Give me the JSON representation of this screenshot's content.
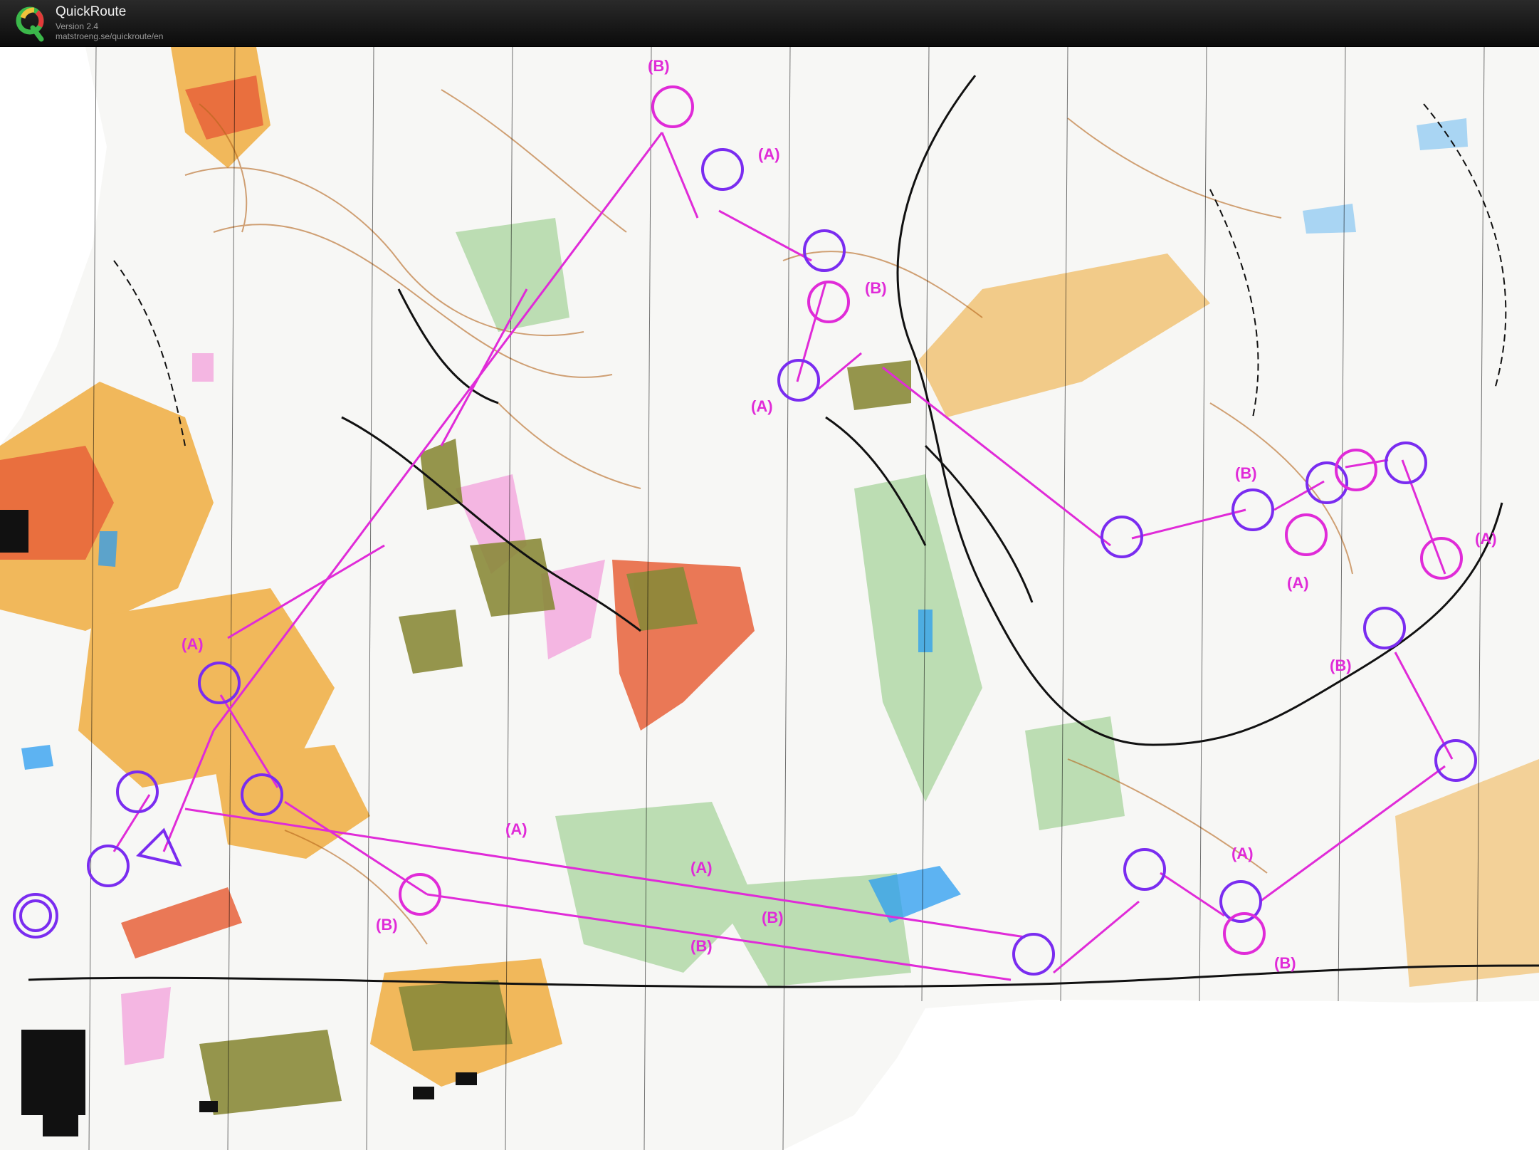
{
  "app": {
    "title": "QuickRoute",
    "version": "Version 2.4",
    "url": "matstroeng.se/quickroute/en",
    "logo_letter": "Q"
  },
  "map": {
    "type": "orienteering map",
    "colors": {
      "course": "#e02bd8",
      "route": "#7a2cf0",
      "open_land": "#f0b04a",
      "forest": "#ffffff",
      "green": "#8cc97c",
      "water": "#2a9df0",
      "contours": "#b5651d",
      "buildings": "#111111",
      "settlement": "#e8623a"
    },
    "icons": [
      "start-triangle-icon",
      "finish-circle-icon",
      "control-circle-icon"
    ],
    "labels": [
      "(B)",
      "(A)",
      "(B)",
      "(A)",
      "(A)",
      "(B)",
      "(A)",
      "(B)",
      "(A)",
      "(B)",
      "(A)",
      "(A)",
      "(B)",
      "(B)",
      "(A)",
      "(B)"
    ]
  }
}
